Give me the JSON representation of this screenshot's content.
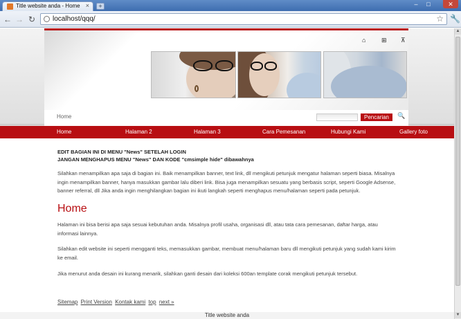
{
  "browser": {
    "tab_title": "Title website anda - Home",
    "tab_close": "×",
    "new_tab": "+",
    "url": "localhost/qqq/",
    "window_buttons": {
      "minimize": "–",
      "maximize": "□",
      "close": "✕"
    },
    "nav": {
      "back": "←",
      "forward": "→",
      "reload": "↻"
    },
    "star": "☆",
    "wrench": "🔧"
  },
  "header": {
    "icons": [
      "home-icon",
      "sitemap-icon",
      "print-icon"
    ],
    "icon_glyphs": [
      "⌂",
      "⊞",
      "⊼"
    ]
  },
  "subnav": {
    "home": "Home",
    "search_placeholder": "",
    "search_button": "Pencarian",
    "search_glyph": "🔍"
  },
  "mainnav": {
    "items": [
      "Home",
      "Halaman 2",
      "Halaman 3",
      "Cara Pemesanan",
      "Hubungi Kami",
      "Gallery foto"
    ]
  },
  "content": {
    "notice_line1": "EDIT BAGIAN INI DI MENU \"News\" SETELAH LOGIN",
    "notice_line2": "JANGAN MENGHAPUS MENU \"News\" DAN KODE \"cmsimple hide\" dibawahnya",
    "intro": "Silahkan menampilkan apa saja di bagian ini. Baik menampilkan banner, text link, dll mengikuti petunjuk mengatur halaman seperti biasa. Misalnya ingin menampilkan banner, hanya masukkan gambar lalu diberi link. Bisa juga menampilkan sesuatu yang berbasis script, seperti Google Adsense, banner referral, dll Jika anda ingin menghilangkan bagian ini ikuti langkah seperti menghapus menu/halaman seperti pada petunjuk.",
    "home_title": "Home",
    "p1": "Halaman ini bisa berisi apa saja sesuai kebutuhan anda. Misalnya profil usaha, organisasi dll, atau tata cara pemesanan, daftar harga, atau informasi lainnya.",
    "p2": "Silahkan edit website ini seperti mengganti teks, memasukkan gambar, membuat menu/halaman baru dll mengikuti petunjuk yang sudah kami kirim ke email.",
    "p3": "Jika menurut anda desain ini kurang menarik, silahkan ganti desain dari koleksi 600an template corak mengikuti petunjuk tersebut."
  },
  "footer": {
    "links": [
      "Sitemap",
      "Print Version",
      "Kontak kami",
      "top",
      "next »"
    ],
    "site_title": "Title website anda"
  },
  "colors": {
    "accent": "#b80e12",
    "chrome_blue": "#3e6db0"
  }
}
